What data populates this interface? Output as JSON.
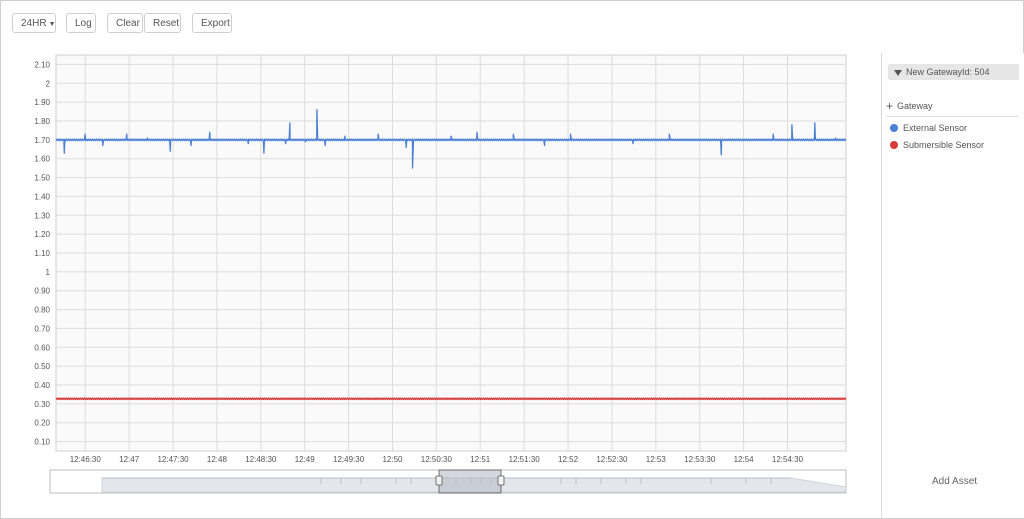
{
  "toolbar": {
    "range_label": "24HR",
    "log_label": "Log",
    "clear_label": "Clear",
    "reset_label": "Reset",
    "export_label": "Export"
  },
  "sidebar": {
    "gateway_header": "New GatewayId: 504",
    "add_gateway_label": "Gateway",
    "sensors": [
      {
        "label": "External Sensor",
        "color": "#4a7fd4"
      },
      {
        "label": "Submersible Sensor",
        "color": "#d93a3a"
      }
    ],
    "add_asset_label": "Add Asset"
  },
  "chart_data": {
    "type": "line",
    "y_ticks": [
      "0.10",
      "0.20",
      "0.30",
      "0.40",
      "0.50",
      "0.60",
      "0.70",
      "0.80",
      "0.90",
      "1",
      "1.10",
      "1.20",
      "1.30",
      "1.40",
      "1.50",
      "1.60",
      "1.70",
      "1.80",
      "1.90",
      "2",
      "2.10"
    ],
    "ylim": [
      0.05,
      2.15
    ],
    "x_ticks": [
      "12:46:30",
      "12:47",
      "12:47:30",
      "12:48",
      "12:48:30",
      "12:49",
      "12:49:30",
      "12:50",
      "12:50:30",
      "12:51",
      "12:51:30",
      "12:52",
      "12:52:30",
      "12:53",
      "12:53:30",
      "12:54",
      "12:54:30"
    ],
    "x_range_seconds": [
      0,
      540
    ],
    "x_tick_start_seconds": 20,
    "grid": true,
    "series": [
      {
        "name": "External Sensor",
        "color": "#4a7fd4",
        "baseline": 1.7,
        "spikes": [
          [
            8,
            1.63
          ],
          [
            28,
            1.73
          ],
          [
            45,
            1.67
          ],
          [
            68,
            1.73
          ],
          [
            88,
            1.71
          ],
          [
            110,
            1.64
          ],
          [
            130,
            1.67
          ],
          [
            148,
            1.74
          ],
          [
            185,
            1.68
          ],
          [
            200,
            1.63
          ],
          [
            221,
            1.68
          ],
          [
            225,
            1.79
          ],
          [
            240,
            1.69
          ],
          [
            251,
            1.86
          ],
          [
            259,
            1.67
          ],
          [
            278,
            1.72
          ],
          [
            310,
            1.73
          ],
          [
            337,
            1.66
          ],
          [
            343,
            1.55
          ],
          [
            380,
            1.72
          ],
          [
            405,
            1.74
          ],
          [
            440,
            1.73
          ],
          [
            470,
            1.67
          ],
          [
            495,
            1.73
          ],
          [
            525,
            1.7
          ],
          [
            555,
            1.68
          ],
          [
            590,
            1.73
          ],
          [
            620,
            1.7
          ],
          [
            640,
            1.62
          ],
          [
            660,
            1.7
          ],
          [
            690,
            1.73
          ],
          [
            702,
            1.7
          ],
          [
            708,
            1.78
          ],
          [
            720,
            1.7
          ],
          [
            730,
            1.79
          ],
          [
            750,
            1.71
          ]
        ],
        "end": 1.7
      },
      {
        "name": "Submersible Sensor",
        "color": "#d93a3a",
        "baseline": 0.327
      }
    ]
  }
}
